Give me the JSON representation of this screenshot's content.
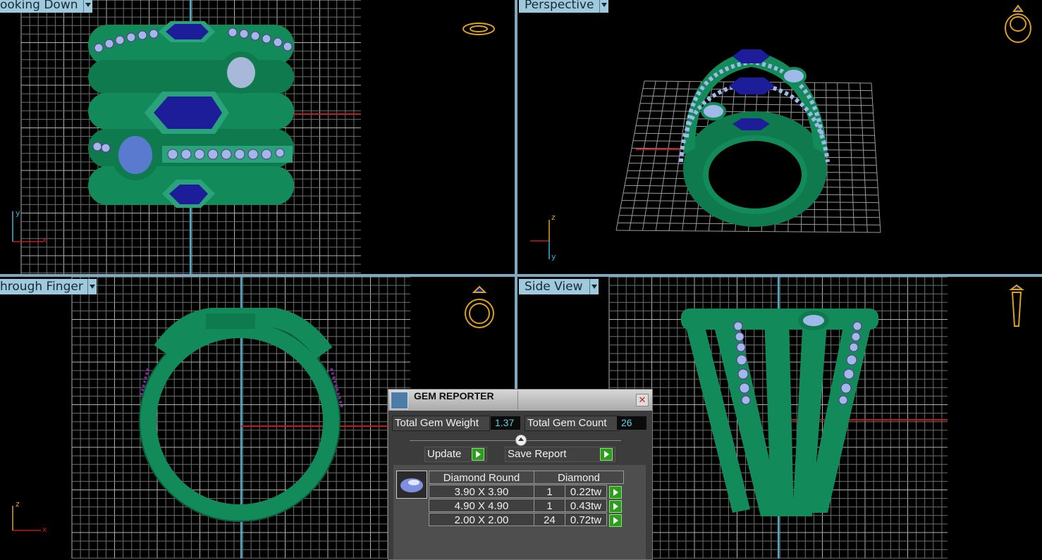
{
  "viewports": {
    "top_left": {
      "label": "ooking Down"
    },
    "top_right": {
      "label": "Perspective"
    },
    "bottom_left": {
      "label": "hrough Finger"
    },
    "bottom_right": {
      "label": "Side View"
    }
  },
  "axes": {
    "x": "x",
    "y": "y",
    "z": "z"
  },
  "colors": {
    "grid": "#8a8a8a",
    "metal": "#138a5a",
    "gem_blue": "#1d1d9a",
    "diamond": "#9fb9e8",
    "axis_red": "#c01a1a",
    "axis_cyan": "#3ab6d6",
    "label_bg": "#9fc9dc",
    "nav_icon": "#d8a21e"
  },
  "gem_reporter": {
    "title": "GEM REPORTER",
    "total_weight_label": "Total Gem Weight",
    "total_weight_value": "1.37",
    "total_count_label": "Total Gem Count",
    "total_count_value": "26",
    "update_label": "Update",
    "save_label": "Save Report",
    "table": {
      "header_shape": "Diamond Round",
      "header_type": "Diamond",
      "rows": [
        {
          "size": "3.90 X 3.90",
          "count": "1",
          "weight": "0.22tw"
        },
        {
          "size": "4.90 X 4.90",
          "count": "1",
          "weight": "0.43tw"
        },
        {
          "size": "2.00 X 2.00",
          "count": "24",
          "weight": "0.72tw"
        }
      ]
    }
  }
}
